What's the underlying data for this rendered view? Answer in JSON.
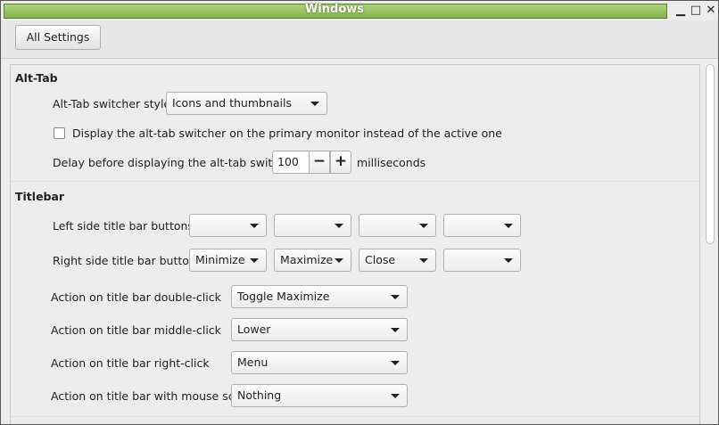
{
  "window": {
    "title": "Windows",
    "minimize_glyph": "▁",
    "maximize_glyph": "□",
    "close_glyph": "✕"
  },
  "toolbar": {
    "all_settings_label": "All Settings"
  },
  "alttab": {
    "section_title": "Alt-Tab",
    "style_label": "Alt-Tab switcher style",
    "style_value": "Icons and thumbnails",
    "primary_monitor_label": "Display the alt-tab switcher on the primary monitor instead of the active one",
    "primary_monitor_checked": false,
    "delay_label": "Delay before displaying the alt-tab switcher",
    "delay_value": "100",
    "delay_minus": "−",
    "delay_plus": "+",
    "delay_unit": "milliseconds"
  },
  "titlebar": {
    "section_title": "Titlebar",
    "left_label": "Left side title bar buttons",
    "left_buttons": [
      "",
      "",
      "",
      ""
    ],
    "right_label": "Right side title bar buttons",
    "right_buttons": [
      "Minimize",
      "Maximize",
      "Close",
      ""
    ],
    "double_click_label": "Action on title bar double-click",
    "double_click_value": "Toggle Maximize",
    "middle_click_label": "Action on title bar middle-click",
    "middle_click_value": "Lower",
    "right_click_label": "Action on title bar right-click",
    "right_click_value": "Menu",
    "scroll_label": "Action on title bar with mouse scroll",
    "scroll_value": "Nothing"
  }
}
